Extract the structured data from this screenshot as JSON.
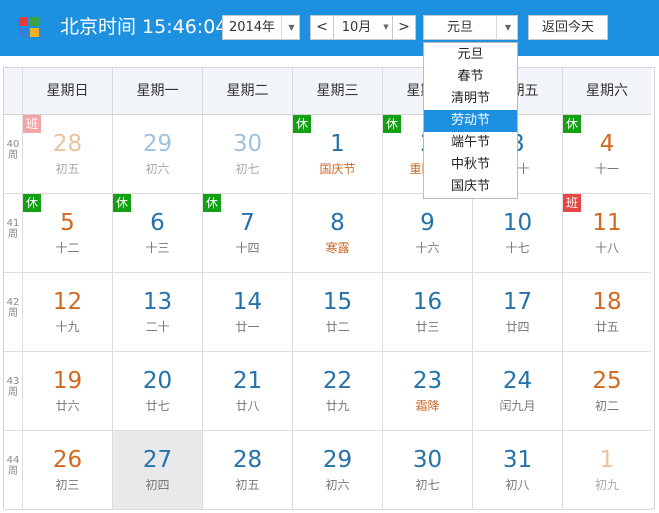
{
  "header": {
    "title": "北京时间 15:46:04",
    "year_select": "2014年",
    "prev_month": "<",
    "month_select": "10月",
    "next_month": ">",
    "holiday_select": "元旦",
    "today_button": "返回今天"
  },
  "holiday_dropdown": {
    "options": [
      "元旦",
      "春节",
      "清明节",
      "劳动节",
      "端午节",
      "中秋节",
      "国庆节"
    ],
    "highlighted": "劳动节"
  },
  "calendar": {
    "weekdays": [
      "星期日",
      "星期一",
      "星期二",
      "星期三",
      "星期四",
      "星期五",
      "星期六"
    ],
    "weeks": [
      {
        "week_label": "40周",
        "days": [
          {
            "day": "28",
            "sub": "初五",
            "muted": true,
            "badge": "班"
          },
          {
            "day": "29",
            "sub": "初六",
            "muted": true
          },
          {
            "day": "30",
            "sub": "初七",
            "muted": true
          },
          {
            "day": "1",
            "sub": "国庆节",
            "badge": "休",
            "holiday": true
          },
          {
            "day": "2",
            "sub": "重阳节",
            "badge": "休",
            "holiday": true
          },
          {
            "day": "3",
            "sub": "初十",
            "badge": "休"
          },
          {
            "day": "4",
            "sub": "十一",
            "badge": "休",
            "weekend": true
          }
        ]
      },
      {
        "week_label": "41周",
        "days": [
          {
            "day": "5",
            "sub": "十二",
            "badge": "休",
            "weekend": true
          },
          {
            "day": "6",
            "sub": "十三",
            "badge": "休"
          },
          {
            "day": "7",
            "sub": "十四",
            "badge": "休"
          },
          {
            "day": "8",
            "sub": "寒露",
            "holiday": true
          },
          {
            "day": "9",
            "sub": "十六"
          },
          {
            "day": "10",
            "sub": "十七"
          },
          {
            "day": "11",
            "sub": "十八",
            "badge": "班",
            "weekend": true
          }
        ]
      },
      {
        "week_label": "42周",
        "days": [
          {
            "day": "12",
            "sub": "十九",
            "weekend": true
          },
          {
            "day": "13",
            "sub": "二十"
          },
          {
            "day": "14",
            "sub": "廿一"
          },
          {
            "day": "15",
            "sub": "廿二"
          },
          {
            "day": "16",
            "sub": "廿三"
          },
          {
            "day": "17",
            "sub": "廿四"
          },
          {
            "day": "18",
            "sub": "廿五",
            "weekend": true
          }
        ]
      },
      {
        "week_label": "43周",
        "days": [
          {
            "day": "19",
            "sub": "廿六",
            "weekend": true
          },
          {
            "day": "20",
            "sub": "廿七"
          },
          {
            "day": "21",
            "sub": "廿八"
          },
          {
            "day": "22",
            "sub": "廿九"
          },
          {
            "day": "23",
            "sub": "霜降",
            "holiday": true
          },
          {
            "day": "24",
            "sub": "闰九月"
          },
          {
            "day": "25",
            "sub": "初二",
            "weekend": true
          }
        ]
      },
      {
        "week_label": "44周",
        "days": [
          {
            "day": "26",
            "sub": "初三",
            "weekend": true
          },
          {
            "day": "27",
            "sub": "初四",
            "selected": true
          },
          {
            "day": "28",
            "sub": "初五"
          },
          {
            "day": "29",
            "sub": "初六"
          },
          {
            "day": "30",
            "sub": "初七"
          },
          {
            "day": "31",
            "sub": "初八"
          },
          {
            "day": "1",
            "sub": "初九",
            "muted": true,
            "weekend": true
          }
        ]
      }
    ]
  },
  "colors": {
    "topbar": "#1e90e0",
    "weekday_number": "#2472a8",
    "weekend_number": "#d2691e",
    "rest_badge": "#14a014",
    "work_badge_current": "#e84545",
    "work_badge_faded": "#f3a5a5"
  }
}
